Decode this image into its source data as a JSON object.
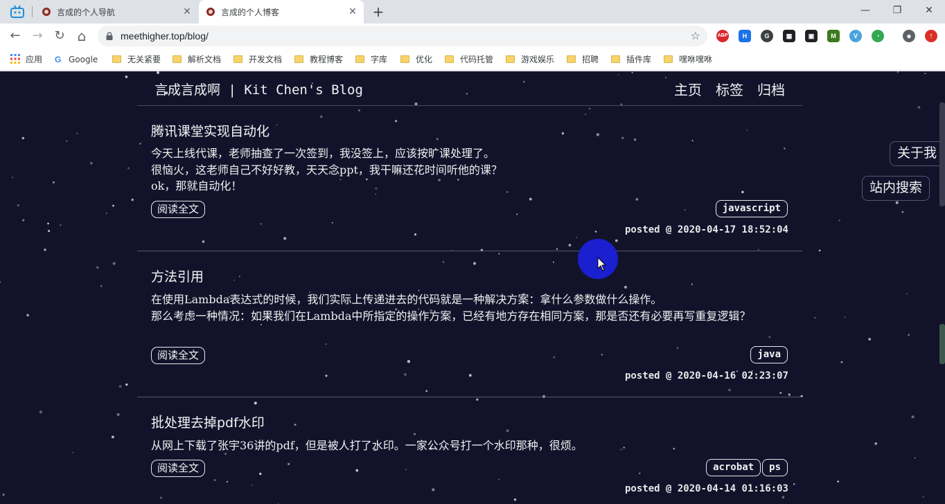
{
  "browser": {
    "tabs": [
      {
        "title": "言成的个人导航",
        "active": false
      },
      {
        "title": "言成的个人博客",
        "active": true
      }
    ],
    "new_tab": "+",
    "window_controls": {
      "minimize": "—",
      "restore": "❐",
      "close": "✕"
    },
    "nav": {
      "back": "←",
      "forward": "→",
      "reload": "↻",
      "home": "⌂"
    },
    "address": "meethigher.top/blog/",
    "star": "☆",
    "extensions": [
      {
        "name": "adblock-plus-icon",
        "label": "ABP",
        "color": "#d9272e"
      },
      {
        "name": "h-extension-icon",
        "label": "H",
        "color": "#1a73e8"
      },
      {
        "name": "g-extension-icon",
        "label": "G",
        "color": "#3c4043"
      },
      {
        "name": "qr-code-icon",
        "label": "▦",
        "color": "#202124"
      },
      {
        "name": "picture-in-picture-icon",
        "label": "▣",
        "color": "#202124"
      },
      {
        "name": "m-extension-icon",
        "label": "M",
        "color": "#3d7a1f"
      },
      {
        "name": "v-extension-icon",
        "label": "V",
        "color": "#4aa3df"
      },
      {
        "name": "speed-extension-icon",
        "label": "◔",
        "color": "#34a853"
      }
    ],
    "profile": "●",
    "update": "↑",
    "bookmarks": [
      {
        "label": "应用",
        "kind": "apps"
      },
      {
        "label": "Google",
        "kind": "google"
      },
      {
        "label": "无关紧要",
        "kind": "folder"
      },
      {
        "label": "解析文档",
        "kind": "folder"
      },
      {
        "label": "开发文档",
        "kind": "folder"
      },
      {
        "label": "教程博客",
        "kind": "folder"
      },
      {
        "label": "字库",
        "kind": "folder"
      },
      {
        "label": "优化",
        "kind": "folder"
      },
      {
        "label": "代码托管",
        "kind": "folder"
      },
      {
        "label": "游戏娱乐",
        "kind": "folder"
      },
      {
        "label": "招聘",
        "kind": "folder"
      },
      {
        "label": "插件库",
        "kind": "folder"
      },
      {
        "label": "嘿咻嘿咻",
        "kind": "folder"
      }
    ]
  },
  "site": {
    "title": "言成言成啊 | Kit Chen's Blog",
    "nav": [
      "主页",
      "标签",
      "归档"
    ],
    "side_buttons": {
      "about": "关于我",
      "search": "站内搜索"
    },
    "background_color": "#12132b"
  },
  "posts": [
    {
      "title": "腾讯课堂实现自动化",
      "body": [
        "今天上线代课，老师抽查了一次签到，我没签上，应该按旷课处理了。",
        "很恼火，这老师自己不好好教，天天念ppt，我干嘛还花时间听他的课？",
        "ok，那就自动化！"
      ],
      "read_more": "阅读全文",
      "tags": [
        "javascript"
      ],
      "posted": "posted @ 2020-04-17 18:52:04"
    },
    {
      "title": "方法引用",
      "body": [
        "在使用Lambda表达式的时候，我们实际上传递进去的代码就是一种解决方案：拿什么参数做什么操作。",
        "那么考虑一种情况：如果我们在Lambda中所指定的操作方案，已经有地方存在相同方案，那是否还有必要再写重复逻辑？"
      ],
      "read_more": "阅读全文",
      "tags": [
        "java"
      ],
      "posted": "posted @ 2020-04-16 02:23:07"
    },
    {
      "title": "批处理去掉pdf水印",
      "body": [
        "从网上下载了张宇36讲的pdf，但是被人打了水印。一家公众号打一个水印那种，很烦。"
      ],
      "read_more": "阅读全文",
      "tags": [
        "acrobat",
        "ps"
      ],
      "posted": "posted @ 2020-04-14 01:16:03"
    }
  ]
}
